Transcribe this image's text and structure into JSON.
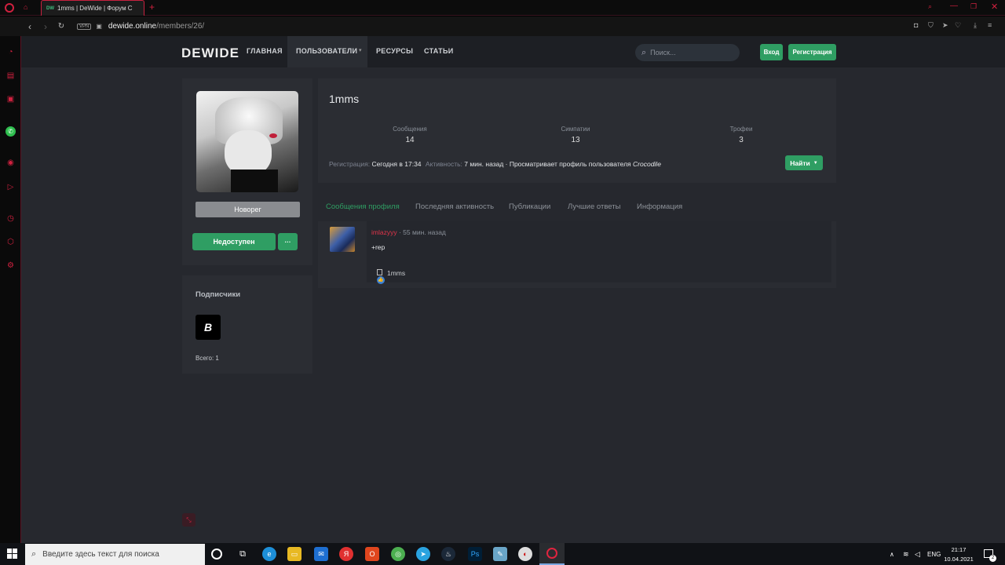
{
  "browser": {
    "tab_title": "1mms | DeWide | Форум С",
    "favicon_text": "DW",
    "url_domain": "dewide.online",
    "url_path": "/members/26/",
    "vpn_badge": "VPN",
    "new_tab": "+"
  },
  "site": {
    "logo": "DEWIDE",
    "nav": {
      "home": "ГЛАВНАЯ",
      "users": "ПОЛЬЗОВАТЕЛИ",
      "resources": "РЕСУРСЫ",
      "articles": "СТАТЬИ"
    },
    "search_placeholder": "Поиск...",
    "login": "Вход",
    "register": "Регистрация"
  },
  "profile": {
    "username": "1mms",
    "role_badge": "Новорег",
    "unavailable_button": "Недоступен",
    "more_button": "···",
    "stats": [
      {
        "label": "Сообщения",
        "value": "14"
      },
      {
        "label": "Симпатии",
        "value": "13"
      },
      {
        "label": "Трофеи",
        "value": "3"
      }
    ],
    "reg_label": "Регистрация:",
    "reg_value": "Сегодня в 17:34",
    "activity_label": "Активность:",
    "activity_value": "7 мин. назад · Просматривает профиль пользователя",
    "activity_user": "Crocodile",
    "find_button": "Найти"
  },
  "followers": {
    "title": "Подписчики",
    "avatar_letter": "B",
    "total": "Всего: 1"
  },
  "tabs": [
    "Сообщения профиля",
    "Последняя активность",
    "Публикации",
    "Лучшие ответы",
    "Информация"
  ],
  "post": {
    "author": "imlazyyy",
    "time": "· 55 мин. назад",
    "text": "+rep",
    "reaction_user": "1mms"
  },
  "taskbar": {
    "search_placeholder": "Введите здесь текст для поиска",
    "lang": "ENG",
    "time": "21:17",
    "date": "10.04.2021",
    "notifications": "2"
  },
  "colors": {
    "accent": "#2f9e63",
    "opera_red": "#d0213f",
    "author_red": "#e0344a"
  }
}
